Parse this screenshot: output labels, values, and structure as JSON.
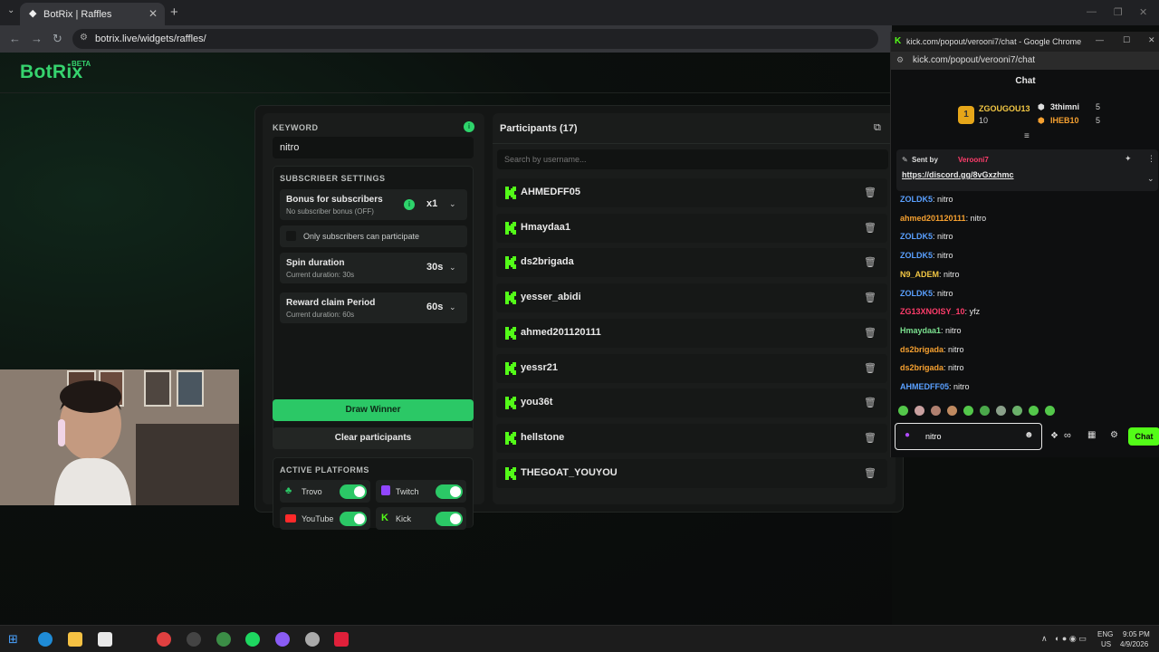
{
  "browser": {
    "tab_title": "BotRix | Raffles",
    "url": "botrix.live/widgets/raffles/"
  },
  "app": {
    "logo": "BotRix",
    "beta": "BETA"
  },
  "settings": {
    "keyword_label": "KEYWORD",
    "keyword_value": "nitro",
    "subscriber_settings_label": "SUBSCRIBER SETTINGS",
    "bonus_title": "Bonus for subscribers",
    "bonus_sub": "No subscriber bonus (OFF)",
    "bonus_value": "x1",
    "only_subs_label": "Only subscribers can participate",
    "spin_title": "Spin duration",
    "spin_sub": "Current duration: 30s",
    "spin_value": "30s",
    "reward_title": "Reward claim Period",
    "reward_sub": "Current duration: 60s",
    "reward_value": "60s",
    "draw_button": "Draw Winner",
    "clear_button": "Clear participants",
    "active_platforms_label": "ACTIVE PLATFORMS",
    "platforms": [
      {
        "name": "Trovo",
        "on": true
      },
      {
        "name": "Twitch",
        "on": true
      },
      {
        "name": "YouTube",
        "on": true
      },
      {
        "name": "Kick",
        "on": true
      }
    ]
  },
  "participants": {
    "title": "Participants (17)",
    "search_placeholder": "Search by username...",
    "list": [
      "AHMEDFF05",
      "Hmaydaa1",
      "ds2brigada",
      "yesser_abidi",
      "ahmed201120111",
      "yessr21",
      "you36t",
      "hellstone",
      "THEGOAT_YOUYOU"
    ]
  },
  "chat": {
    "window_title": "kick.com/popout/verooni7/chat - Google Chrome",
    "url": "kick.com/popout/verooni7/chat",
    "header": "Chat",
    "leaders": {
      "first_name": "ZGOUGOU13",
      "first_count": "10",
      "second_name": "3thimni",
      "second_count": "5",
      "third_name": "IHEB10",
      "third_count": "5"
    },
    "pinned_sent_by": "Sent by",
    "pinned_user": "Verooni7",
    "pinned_link": "https://discord.gg/8vGxzhmc",
    "messages": [
      {
        "user": "ZOLDK5",
        "text": "nitro",
        "cls": "u-blue"
      },
      {
        "user": "ahmed201120111",
        "text": "nitro",
        "cls": "u-orange"
      },
      {
        "user": "ZOLDK5",
        "text": "nitro",
        "cls": "u-blue"
      },
      {
        "user": "ZOLDK5",
        "text": "nitro",
        "cls": "u-blue"
      },
      {
        "user": "N9_ADEM",
        "text": "nitro",
        "cls": "u-yellow"
      },
      {
        "user": "ZOLDK5",
        "text": "nitro",
        "cls": "u-blue"
      },
      {
        "user": "ZG13XNOISY_10",
        "text": "yfz",
        "cls": "u-red"
      },
      {
        "user": "Hmaydaa1",
        "text": "nitro",
        "cls": "u-green"
      },
      {
        "user": "ds2brigada",
        "text": "nitro",
        "cls": "u-orange"
      },
      {
        "user": "ds2brigada",
        "text": "nitro",
        "cls": "u-orange"
      },
      {
        "user": "AHMEDFF05",
        "text": "nitro",
        "cls": "u-blue"
      }
    ],
    "input_value": "nitro",
    "send_button": "Chat"
  },
  "taskbar": {
    "lang": "ENG",
    "region": "US",
    "time": "9:05 PM",
    "date": "4/9/2026"
  }
}
